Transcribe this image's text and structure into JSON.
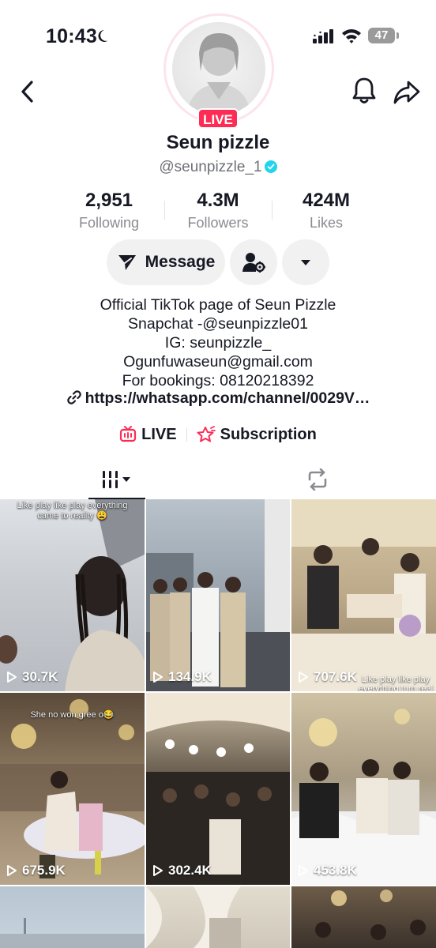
{
  "status_bar": {
    "time": "10:43",
    "battery": "47"
  },
  "profile": {
    "live_badge": "LIVE",
    "display_name": "Seun pizzle",
    "username": "@seunpizzle_1"
  },
  "stats": [
    {
      "value": "2,951",
      "label": "Following"
    },
    {
      "value": "4.3M",
      "label": "Followers"
    },
    {
      "value": "424M",
      "label": "Likes"
    }
  ],
  "actions": {
    "message_label": "Message"
  },
  "bio": {
    "lines": [
      "Official TikTok page of Seun Pizzle",
      "Snapchat -@seunpizzle01",
      "IG: seunpizzle_",
      "Ogunfuwaseun@gmail.com",
      "For bookings: 08120218392"
    ],
    "link": "https://whatsapp.com/channel/0029V…"
  },
  "features": {
    "live_label": "LIVE",
    "subscription_label": "Subscription"
  },
  "videos": [
    {
      "views": "30.7K",
      "caption": "Like play like play everything came to reality 😩"
    },
    {
      "views": "134.9K",
      "caption": ""
    },
    {
      "views": "707.6K",
      "caption": "Like play like play everything turn real 😂😂"
    },
    {
      "views": "675.9K",
      "caption": "She no won gree o😂"
    },
    {
      "views": "302.4K",
      "caption": ""
    },
    {
      "views": "453.8K",
      "caption": ""
    },
    {
      "views": "",
      "caption": ""
    },
    {
      "views": "",
      "caption": ""
    },
    {
      "views": "",
      "caption": ""
    }
  ],
  "colors": {
    "accent": "#fe2c55",
    "verified": "#20d5ec",
    "button_bg": "#f1f1f2"
  }
}
